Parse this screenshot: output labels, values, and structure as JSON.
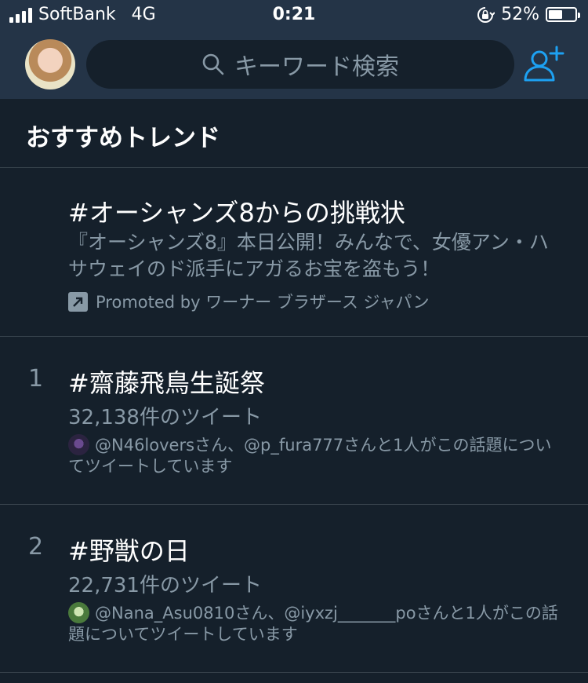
{
  "status_bar": {
    "carrier": "SoftBank",
    "network": "4G",
    "time": "0:21",
    "battery_percent": "52%",
    "battery_level": 0.52
  },
  "header": {
    "search_placeholder": "キーワード検索",
    "icons": {
      "search": "search-icon",
      "add_user": "add-user-icon",
      "avatar": "profile-avatar"
    }
  },
  "section": {
    "title": "おすすめトレンド"
  },
  "promoted_trend": {
    "title": "#オーシャンズ8からの挑戦状",
    "description": "『オーシャンズ8』本日公開！みんなで、女優アン・ハサウェイのド派手にアガるお宝を盗もう！",
    "promoted_label": "Promoted by ワーナー ブラザース ジャパン"
  },
  "trends": [
    {
      "rank": "1",
      "title": "#齋藤飛鳥生誕祭",
      "tweet_count": "32,138件のツイート",
      "context": "@N46loversさん、@p_fura777さんと1人がこの話題についてツイートしています"
    },
    {
      "rank": "2",
      "title": "#野獣の日",
      "tweet_count": "22,731件のツイート",
      "context": "@Nana_Asu0810さん、@iyxzj_______poさんと1人がこの話題についてツイートしています"
    }
  ],
  "colors": {
    "background": "#15202b",
    "header_bg": "#243447",
    "secondary_text": "#8899a6",
    "accent": "#1da1f2",
    "divider": "#38444d"
  }
}
